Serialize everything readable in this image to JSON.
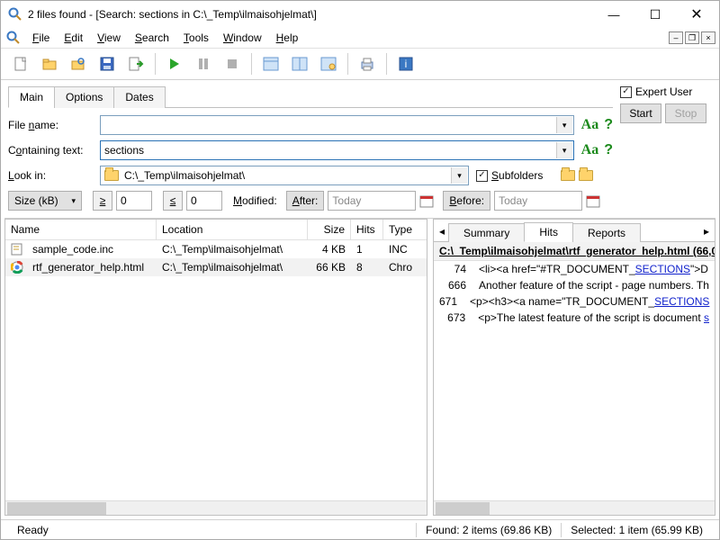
{
  "window": {
    "title": "2 files found - [Search: sections in C:\\_Temp\\ilmaisohjelmat\\]"
  },
  "menu": {
    "items": [
      "File",
      "Edit",
      "View",
      "Search",
      "Tools",
      "Window",
      "Help"
    ]
  },
  "search_tabs": {
    "main": "Main",
    "options": "Options",
    "dates": "Dates"
  },
  "form": {
    "file_name_label": "File name:",
    "file_name_value": "",
    "containing_label": "Containing text:",
    "containing_value": "sections",
    "lookin_label": "Look in:",
    "lookin_value": "C:\\_Temp\\ilmaisohjelmat\\",
    "subfolders_label": "Subfolders",
    "subfolders_checked": true,
    "size_label": "Size (kB)",
    "ge_value": "0",
    "le_value": "0",
    "modified_label": "Modified:",
    "after_label": "After:",
    "after_value": "Today",
    "before_label": "Before:",
    "before_value": "Today"
  },
  "right_controls": {
    "expert_label": "Expert User",
    "expert_checked": true,
    "start": "Start",
    "stop": "Stop"
  },
  "results": {
    "headers": {
      "name": "Name",
      "location": "Location",
      "size": "Size",
      "hits": "Hits",
      "type": "Type"
    },
    "rows": [
      {
        "name": "sample_code.inc",
        "location": "C:\\_Temp\\ilmaisohjelmat\\",
        "size": "4 KB",
        "hits": "1",
        "type": "INC",
        "icon": "doc"
      },
      {
        "name": "rtf_generator_help.html",
        "location": "C:\\_Temp\\ilmaisohjelmat\\",
        "size": "66 KB",
        "hits": "8",
        "type": "Chro",
        "icon": "chrome",
        "selected": true
      }
    ]
  },
  "detail": {
    "tabs": {
      "summary": "Summary",
      "hits": "Hits",
      "reports": "Reports"
    },
    "file_header": "C:\\_Temp\\ilmaisohjelmat\\rtf_generator_help.html  (66,0",
    "lines": [
      {
        "n": "74",
        "pre": "<li><a href=\"#TR_DOCUMENT_",
        "hl": "SECTIONS",
        "post": "\">D"
      },
      {
        "n": "666",
        "pre": "Another feature of the script - page numbers. Th",
        "hl": "",
        "post": ""
      },
      {
        "n": "671",
        "pre": "<p><h3><a name=\"TR_DOCUMENT_",
        "hl": "SECTIONS",
        "post": ""
      },
      {
        "n": "673",
        "pre": "<p>The latest feature of the script is document ",
        "hl": "s",
        "post": ""
      }
    ]
  },
  "status": {
    "ready": "Ready",
    "found": "Found: 2 items (69.86 KB)",
    "selected": "Selected: 1 item (65.99 KB)"
  }
}
